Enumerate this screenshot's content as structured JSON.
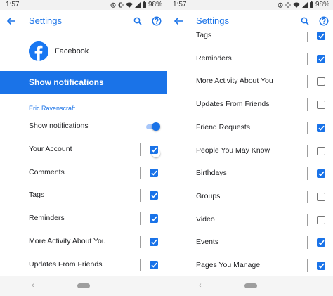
{
  "colors": {
    "accent": "#1a73e8",
    "facebook": "#1877f2",
    "text": "#202124"
  },
  "status_bar": {
    "time": "1:57",
    "battery": "98%",
    "icons": [
      "alarm-icon",
      "vibrate-icon",
      "wifi-icon",
      "signal-icon",
      "battery-icon"
    ]
  },
  "app_bar": {
    "title": "Settings",
    "icons": [
      "back-arrow-icon",
      "search-icon",
      "help-icon"
    ]
  },
  "left": {
    "app_name": "Facebook",
    "master_toggle": {
      "label": "Show notifications",
      "on": true
    },
    "account": "Eric Ravenscraft",
    "show_notifications": {
      "label": "Show notifications",
      "on": true
    },
    "items": [
      {
        "label": "Your Account",
        "checked": true
      },
      {
        "label": "Comments",
        "checked": true
      },
      {
        "label": "Tags",
        "checked": true
      },
      {
        "label": "Reminders",
        "checked": true
      },
      {
        "label": "More Activity About You",
        "checked": true
      },
      {
        "label": "Updates From Friends",
        "checked": true
      }
    ]
  },
  "right": {
    "items": [
      {
        "label": "Tags",
        "checked": true
      },
      {
        "label": "Reminders",
        "checked": true
      },
      {
        "label": "More Activity About You",
        "checked": false
      },
      {
        "label": "Updates From Friends",
        "checked": false
      },
      {
        "label": "Friend Requests",
        "checked": true
      },
      {
        "label": "People You May Know",
        "checked": false
      },
      {
        "label": "Birthdays",
        "checked": true
      },
      {
        "label": "Groups",
        "checked": false
      },
      {
        "label": "Video",
        "checked": false
      },
      {
        "label": "Events",
        "checked": true
      },
      {
        "label": "Pages You Manage",
        "checked": true
      }
    ]
  },
  "nav_bar": {
    "back_glyph": "‹",
    "icons": [
      "nav-back-icon",
      "nav-home-icon"
    ]
  }
}
